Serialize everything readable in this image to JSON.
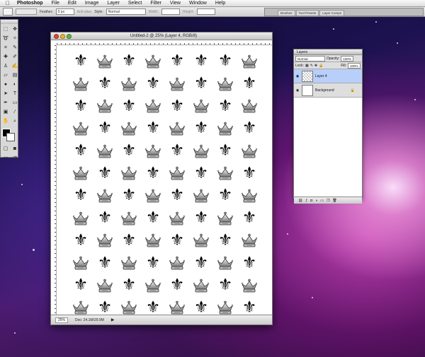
{
  "menubar": {
    "app": "Photoshop",
    "items": [
      "File",
      "Edit",
      "Image",
      "Layer",
      "Select",
      "Filter",
      "View",
      "Window",
      "Help"
    ]
  },
  "options": {
    "feather_label": "Feather:",
    "feather_value": "0 px",
    "antialias_label": "Anti-alias",
    "style_label": "Style:",
    "style_value": "Normal",
    "width_label": "Width:",
    "height_label": "Height:",
    "palette_tabs": [
      "Brushes",
      "Tool Presets",
      "Layer Comps"
    ]
  },
  "document": {
    "title": "Untitled-2 @ 25% (Layer 4, RGB/8)",
    "zoom": "25%",
    "doc_info": "Doc: 24.1M/29.9M",
    "pattern": [
      [
        "fleur",
        "crown",
        "fleur",
        "crown",
        "fleur",
        "fleur",
        "fleur",
        "crown"
      ],
      [
        "crown",
        "fleur",
        "crown",
        "fleur",
        "crown",
        "fleur",
        "crown",
        "fleur"
      ],
      [
        "fleur",
        "crown",
        "fleur",
        "crown",
        "fleur",
        "crown",
        "fleur",
        "crown"
      ],
      [
        "crown",
        "fleur",
        "crown",
        "fleur",
        "crown",
        "fleur",
        "crown",
        "fleur"
      ],
      [
        "fleur",
        "crown",
        "fleur",
        "crown",
        "fleur",
        "crown",
        "fleur",
        "crown"
      ],
      [
        "crown",
        "fleur",
        "crown",
        "fleur",
        "crown",
        "fleur",
        "crown",
        "fleur"
      ],
      [
        "fleur",
        "crown",
        "fleur",
        "crown",
        "fleur",
        "crown",
        "fleur",
        "crown"
      ],
      [
        "crown",
        "fleur",
        "crown",
        "fleur",
        "crown",
        "fleur",
        "crown",
        "fleur"
      ],
      [
        "fleur",
        "crown",
        "fleur",
        "crown",
        "fleur",
        "crown",
        "fleur",
        "crown"
      ],
      [
        "crown",
        "fleur",
        "crown",
        "fleur",
        "crown",
        "fleur",
        "crown",
        "fleur"
      ],
      [
        "fleur",
        "crown",
        "fleur",
        "crown",
        "fleur",
        "crown",
        "fleur",
        "crown"
      ],
      [
        "crown",
        "fleur",
        "crown",
        "fleur",
        "crown",
        "fleur",
        "crown",
        "fleur"
      ],
      [
        "fleur",
        "crown",
        "fleur",
        "crown",
        "fleur",
        "crown",
        "fleur",
        "crown"
      ]
    ]
  },
  "layers_panel": {
    "tab": "Layers",
    "blend_mode": "Normal",
    "opacity_label": "Opacity:",
    "opacity_value": "100%",
    "lock_label": "Lock:",
    "fill_label": "Fill:",
    "fill_value": "100%",
    "layers": [
      {
        "name": "Layer 4",
        "active": true
      },
      {
        "name": "Background",
        "active": false
      }
    ]
  }
}
